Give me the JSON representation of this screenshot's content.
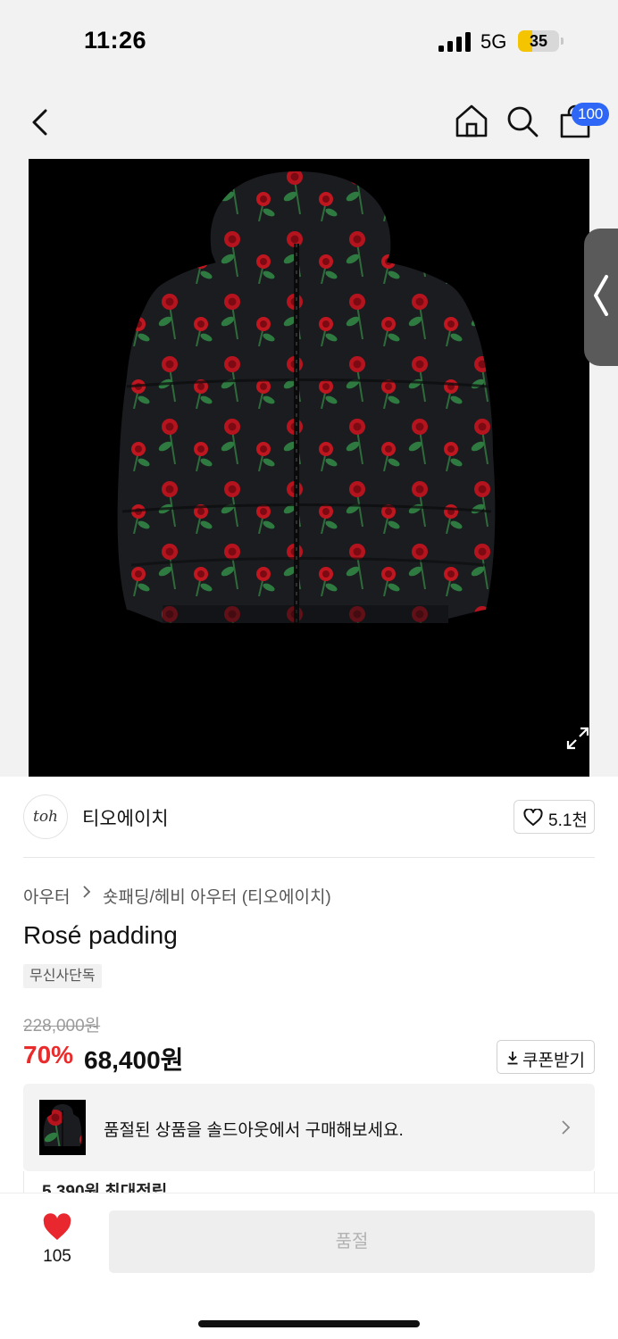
{
  "status_bar": {
    "time": "11:26",
    "network": "5G",
    "battery_level": "35",
    "battery_fraction": 0.35
  },
  "nav": {
    "icons": [
      "back-icon",
      "home-icon",
      "search-icon",
      "cart-icon"
    ],
    "cart_badge": "100",
    "badge_color": "#2e67f6"
  },
  "product": {
    "image_alt": "rose print padded jacket",
    "expand_icon": "expand-icon",
    "side_handle_icon": "chevron-left-icon"
  },
  "brand": {
    "logo_text": "toh",
    "name": "티오에이치",
    "like_count": "5.1천"
  },
  "breadcrumb": {
    "items": [
      "아우터",
      "숏패딩/헤비 아우터 (티오에이치)"
    ]
  },
  "info": {
    "title": "Rosé padding",
    "tag": "무신사단독",
    "original_price": "228,000원",
    "discount": "70%",
    "sale_price": "68,400원",
    "coupon_label": "쿠폰받기",
    "accent_color": "#ea2b2b"
  },
  "soldout_banner": {
    "text": "품절된 상품을 솔드아웃에서 구매해보세요."
  },
  "points": {
    "text": "5,390원 최대적립"
  },
  "bottom_bar": {
    "like_count": "105",
    "buy_label": "품절",
    "heart_color": "#e8282e"
  }
}
